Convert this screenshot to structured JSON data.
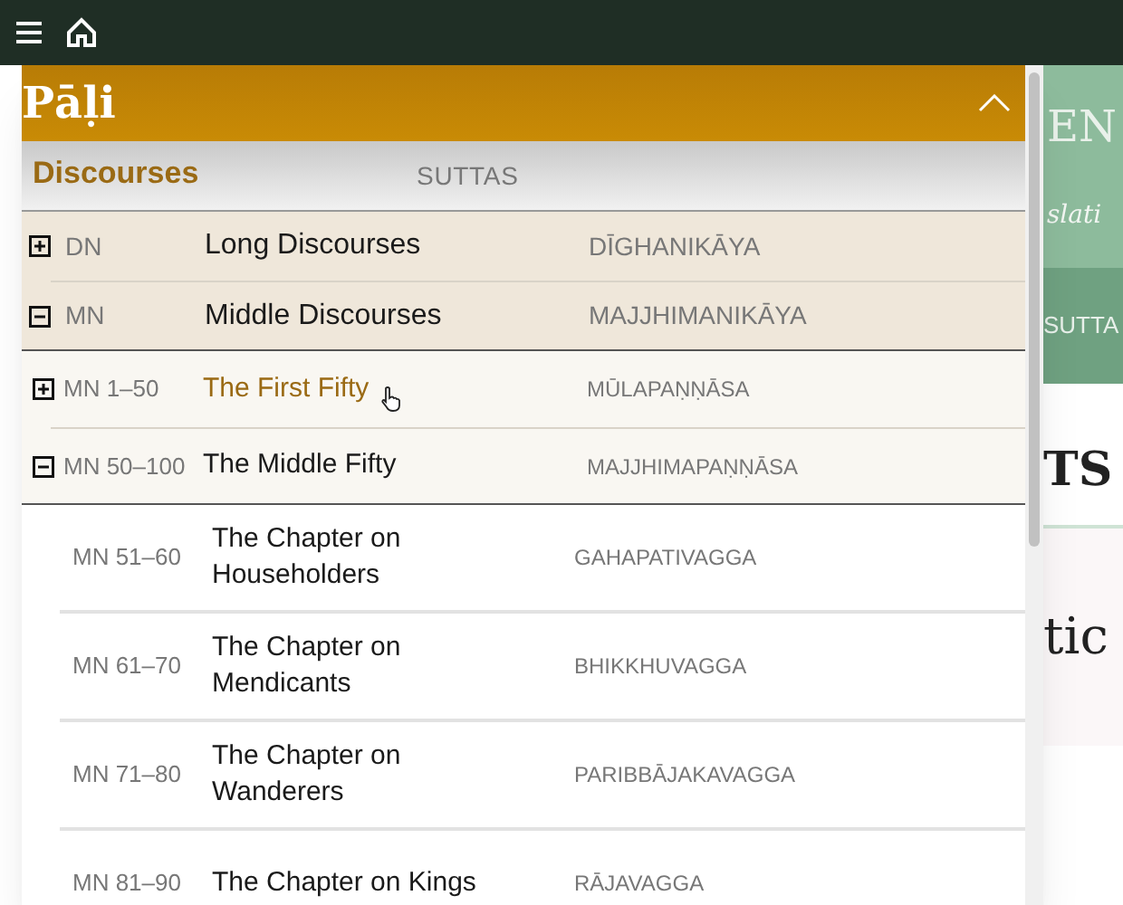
{
  "background": {
    "texts": [
      "EN",
      "slati",
      "SUTTA",
      "TS",
      "tic"
    ]
  },
  "panel": {
    "title": "Pāḷi",
    "expanded": true,
    "section": {
      "title": "Discourses",
      "subtitle": "SUTTAS"
    },
    "collections": [
      {
        "code": "DN",
        "title": "Long Discourses",
        "pali": "DĪGHANIKĀYA",
        "expanded": false
      },
      {
        "code": "MN",
        "title": "Middle Discourses",
        "pali": "MAJJHIMANIKĀYA",
        "expanded": true,
        "children": [
          {
            "code": "MN 1–50",
            "title": "The First Fifty",
            "pali": "MŪLAPAṆṆĀSA",
            "expanded": false,
            "hovered": true
          },
          {
            "code": "MN 50–100",
            "title": "The Middle Fifty",
            "pali": "MAJJHIMAPAṆṆĀSA",
            "expanded": true,
            "hovered": false,
            "children": [
              {
                "code": "MN 51–60",
                "title": "The Chapter on Householders",
                "pali": "GAHAPATIVAGGA"
              },
              {
                "code": "MN 61–70",
                "title": "The Chapter on Mendicants",
                "pali": "BHIKKHUVAGGA"
              },
              {
                "code": "MN 71–80",
                "title": "The Chapter on Wanderers",
                "pali": "PARIBBĀJAKAVAGGA"
              },
              {
                "code": "MN 81–90",
                "title": "The Chapter on Kings",
                "pali": "RĀJAVAGGA"
              }
            ]
          }
        ]
      }
    ]
  }
}
